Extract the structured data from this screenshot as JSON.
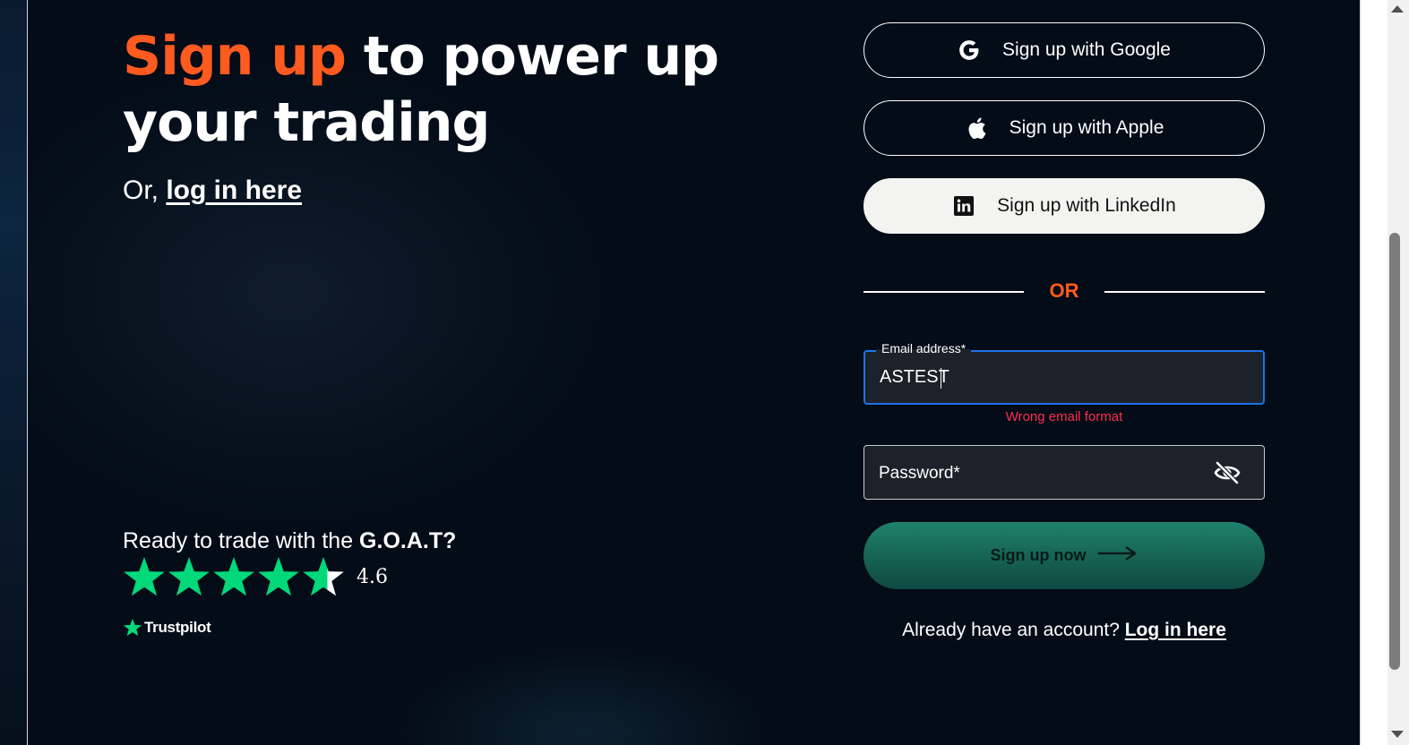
{
  "hero": {
    "headline_accent": "Sign up",
    "headline_rest": " to power up your trading",
    "or_prefix": "Or, ",
    "login_link": "log in here"
  },
  "social_proof": {
    "ready_text": "Ready to trade with the ",
    "ready_bold": "G.O.A.T?",
    "rating": "4.6",
    "stars_filled": 4.6,
    "stars_total": 5,
    "trustpilot_label": "Trustpilot"
  },
  "auth": {
    "google_label": "Sign up with Google",
    "apple_label": "Sign up with Apple",
    "linkedin_label": "Sign up with LinkedIn",
    "or_label": "OR",
    "email_label": "Email address*",
    "email_value": "ASTEST",
    "email_error": "Wrong email format",
    "password_placeholder": "Password*",
    "password_value": "",
    "submit_label": "Sign up now",
    "already_text": "Already have an account? ",
    "already_link": "Log in here"
  },
  "colors": {
    "accent": "#ff5a1f",
    "background": "#030c17",
    "error": "#ff2d52",
    "focus_border": "#1e73e8",
    "submit_green": "#1a7561",
    "trustpilot_green": "#00d87a"
  },
  "icons": {
    "google": "google-icon",
    "apple": "apple-icon",
    "linkedin": "linkedin-icon",
    "password_toggle": "eye-slash-icon",
    "submit_arrow": "arrow-right-icon",
    "trustpilot": "star-icon"
  }
}
